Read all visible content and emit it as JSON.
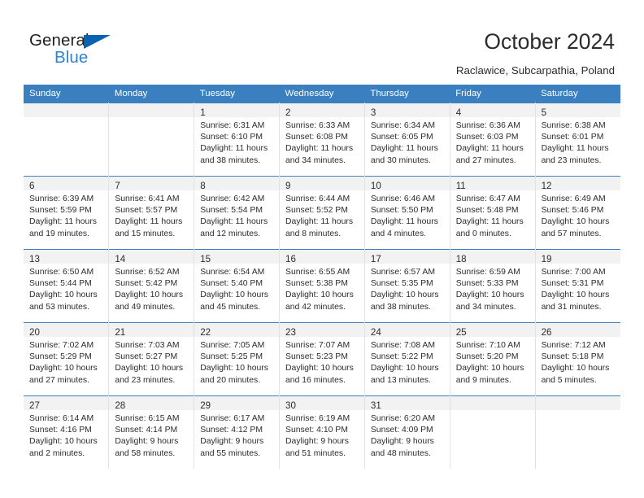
{
  "logo": {
    "word_top": "General",
    "word_bottom": "Blue",
    "triangle_color": "#0a63b0",
    "blue_color": "#2e83d2",
    "dark_color": "#231f20"
  },
  "header": {
    "title": "October 2024",
    "subtitle": "Raclawice, Subcarpathia, Poland"
  },
  "theme": {
    "header_band": "#3a7fbf",
    "daynum_strip": "#f2f2f2",
    "row_rule": "#3a7fbf",
    "col_rule": "#e2e2e2",
    "text": "#2c2c2c"
  },
  "labels": {
    "sunrise_prefix": "Sunrise:",
    "sunset_prefix": "Sunset:",
    "daylight_prefix": "Daylight:"
  },
  "weekdays": [
    "Sunday",
    "Monday",
    "Tuesday",
    "Wednesday",
    "Thursday",
    "Friday",
    "Saturday"
  ],
  "weeks": [
    [
      {
        "day": ""
      },
      {
        "day": ""
      },
      {
        "day": "1",
        "sunrise": "Sunrise: 6:31 AM",
        "sunset": "Sunset: 6:10 PM",
        "daylight_a": "Daylight: 11 hours",
        "daylight_b": "and 38 minutes."
      },
      {
        "day": "2",
        "sunrise": "Sunrise: 6:33 AM",
        "sunset": "Sunset: 6:08 PM",
        "daylight_a": "Daylight: 11 hours",
        "daylight_b": "and 34 minutes."
      },
      {
        "day": "3",
        "sunrise": "Sunrise: 6:34 AM",
        "sunset": "Sunset: 6:05 PM",
        "daylight_a": "Daylight: 11 hours",
        "daylight_b": "and 30 minutes."
      },
      {
        "day": "4",
        "sunrise": "Sunrise: 6:36 AM",
        "sunset": "Sunset: 6:03 PM",
        "daylight_a": "Daylight: 11 hours",
        "daylight_b": "and 27 minutes."
      },
      {
        "day": "5",
        "sunrise": "Sunrise: 6:38 AM",
        "sunset": "Sunset: 6:01 PM",
        "daylight_a": "Daylight: 11 hours",
        "daylight_b": "and 23 minutes."
      }
    ],
    [
      {
        "day": "6",
        "sunrise": "Sunrise: 6:39 AM",
        "sunset": "Sunset: 5:59 PM",
        "daylight_a": "Daylight: 11 hours",
        "daylight_b": "and 19 minutes."
      },
      {
        "day": "7",
        "sunrise": "Sunrise: 6:41 AM",
        "sunset": "Sunset: 5:57 PM",
        "daylight_a": "Daylight: 11 hours",
        "daylight_b": "and 15 minutes."
      },
      {
        "day": "8",
        "sunrise": "Sunrise: 6:42 AM",
        "sunset": "Sunset: 5:54 PM",
        "daylight_a": "Daylight: 11 hours",
        "daylight_b": "and 12 minutes."
      },
      {
        "day": "9",
        "sunrise": "Sunrise: 6:44 AM",
        "sunset": "Sunset: 5:52 PM",
        "daylight_a": "Daylight: 11 hours",
        "daylight_b": "and 8 minutes."
      },
      {
        "day": "10",
        "sunrise": "Sunrise: 6:46 AM",
        "sunset": "Sunset: 5:50 PM",
        "daylight_a": "Daylight: 11 hours",
        "daylight_b": "and 4 minutes."
      },
      {
        "day": "11",
        "sunrise": "Sunrise: 6:47 AM",
        "sunset": "Sunset: 5:48 PM",
        "daylight_a": "Daylight: 11 hours",
        "daylight_b": "and 0 minutes."
      },
      {
        "day": "12",
        "sunrise": "Sunrise: 6:49 AM",
        "sunset": "Sunset: 5:46 PM",
        "daylight_a": "Daylight: 10 hours",
        "daylight_b": "and 57 minutes."
      }
    ],
    [
      {
        "day": "13",
        "sunrise": "Sunrise: 6:50 AM",
        "sunset": "Sunset: 5:44 PM",
        "daylight_a": "Daylight: 10 hours",
        "daylight_b": "and 53 minutes."
      },
      {
        "day": "14",
        "sunrise": "Sunrise: 6:52 AM",
        "sunset": "Sunset: 5:42 PM",
        "daylight_a": "Daylight: 10 hours",
        "daylight_b": "and 49 minutes."
      },
      {
        "day": "15",
        "sunrise": "Sunrise: 6:54 AM",
        "sunset": "Sunset: 5:40 PM",
        "daylight_a": "Daylight: 10 hours",
        "daylight_b": "and 45 minutes."
      },
      {
        "day": "16",
        "sunrise": "Sunrise: 6:55 AM",
        "sunset": "Sunset: 5:38 PM",
        "daylight_a": "Daylight: 10 hours",
        "daylight_b": "and 42 minutes."
      },
      {
        "day": "17",
        "sunrise": "Sunrise: 6:57 AM",
        "sunset": "Sunset: 5:35 PM",
        "daylight_a": "Daylight: 10 hours",
        "daylight_b": "and 38 minutes."
      },
      {
        "day": "18",
        "sunrise": "Sunrise: 6:59 AM",
        "sunset": "Sunset: 5:33 PM",
        "daylight_a": "Daylight: 10 hours",
        "daylight_b": "and 34 minutes."
      },
      {
        "day": "19",
        "sunrise": "Sunrise: 7:00 AM",
        "sunset": "Sunset: 5:31 PM",
        "daylight_a": "Daylight: 10 hours",
        "daylight_b": "and 31 minutes."
      }
    ],
    [
      {
        "day": "20",
        "sunrise": "Sunrise: 7:02 AM",
        "sunset": "Sunset: 5:29 PM",
        "daylight_a": "Daylight: 10 hours",
        "daylight_b": "and 27 minutes."
      },
      {
        "day": "21",
        "sunrise": "Sunrise: 7:03 AM",
        "sunset": "Sunset: 5:27 PM",
        "daylight_a": "Daylight: 10 hours",
        "daylight_b": "and 23 minutes."
      },
      {
        "day": "22",
        "sunrise": "Sunrise: 7:05 AM",
        "sunset": "Sunset: 5:25 PM",
        "daylight_a": "Daylight: 10 hours",
        "daylight_b": "and 20 minutes."
      },
      {
        "day": "23",
        "sunrise": "Sunrise: 7:07 AM",
        "sunset": "Sunset: 5:23 PM",
        "daylight_a": "Daylight: 10 hours",
        "daylight_b": "and 16 minutes."
      },
      {
        "day": "24",
        "sunrise": "Sunrise: 7:08 AM",
        "sunset": "Sunset: 5:22 PM",
        "daylight_a": "Daylight: 10 hours",
        "daylight_b": "and 13 minutes."
      },
      {
        "day": "25",
        "sunrise": "Sunrise: 7:10 AM",
        "sunset": "Sunset: 5:20 PM",
        "daylight_a": "Daylight: 10 hours",
        "daylight_b": "and 9 minutes."
      },
      {
        "day": "26",
        "sunrise": "Sunrise: 7:12 AM",
        "sunset": "Sunset: 5:18 PM",
        "daylight_a": "Daylight: 10 hours",
        "daylight_b": "and 5 minutes."
      }
    ],
    [
      {
        "day": "27",
        "sunrise": "Sunrise: 6:14 AM",
        "sunset": "Sunset: 4:16 PM",
        "daylight_a": "Daylight: 10 hours",
        "daylight_b": "and 2 minutes."
      },
      {
        "day": "28",
        "sunrise": "Sunrise: 6:15 AM",
        "sunset": "Sunset: 4:14 PM",
        "daylight_a": "Daylight: 9 hours",
        "daylight_b": "and 58 minutes."
      },
      {
        "day": "29",
        "sunrise": "Sunrise: 6:17 AM",
        "sunset": "Sunset: 4:12 PM",
        "daylight_a": "Daylight: 9 hours",
        "daylight_b": "and 55 minutes."
      },
      {
        "day": "30",
        "sunrise": "Sunrise: 6:19 AM",
        "sunset": "Sunset: 4:10 PM",
        "daylight_a": "Daylight: 9 hours",
        "daylight_b": "and 51 minutes."
      },
      {
        "day": "31",
        "sunrise": "Sunrise: 6:20 AM",
        "sunset": "Sunset: 4:09 PM",
        "daylight_a": "Daylight: 9 hours",
        "daylight_b": "and 48 minutes."
      },
      {
        "day": ""
      },
      {
        "day": ""
      }
    ]
  ]
}
